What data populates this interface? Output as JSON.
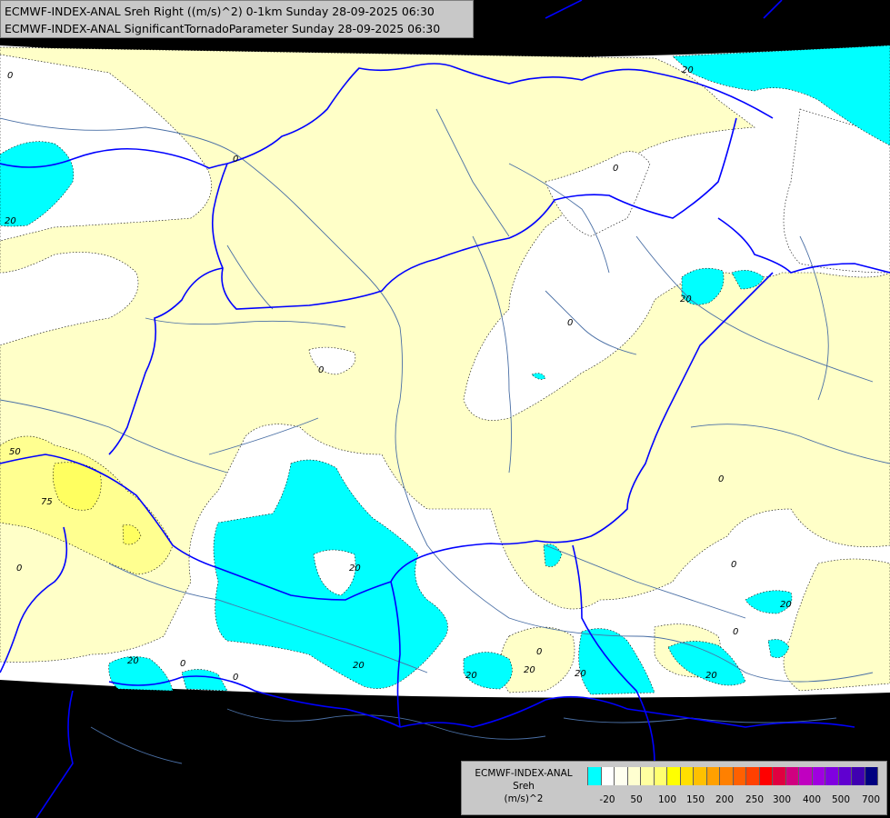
{
  "header": {
    "line1": "ECMWF-INDEX-ANAL Sreh Right ((m/s)^2) 0-1km Sunday 28-09-2025 06:30",
    "line2": "ECMWF-INDEX-ANAL SignificantTornadoParameter Sunday 28-09-2025 06:30"
  },
  "legend": {
    "title_line1": "ECMWF-INDEX-ANAL",
    "title_line2": "Sreh",
    "title_line3": "(m/s)^2",
    "swatch_colors": [
      "#00ffff",
      "#ffffff",
      "#fffff0",
      "#ffffd0",
      "#ffffa0",
      "#ffff70",
      "#ffff00",
      "#ffe000",
      "#ffc000",
      "#ffa000",
      "#ff8000",
      "#ff6000",
      "#ff4000",
      "#ff0000",
      "#e00040",
      "#d00080",
      "#c000c0",
      "#a000e0",
      "#8000e0",
      "#6000d0",
      "#4000b0",
      "#000080"
    ],
    "ticks": [
      "-20",
      "50",
      "100",
      "150",
      "200",
      "250",
      "300",
      "400",
      "500",
      "700"
    ]
  },
  "map_colors": {
    "background": "#000000",
    "white_field": "#ffffff",
    "pale_yellow": "#ffffc8",
    "yellow": "#ffff80",
    "cyan": "#00ffff",
    "border": "#0000ff",
    "river": "#4a6fa5"
  },
  "contour_labels": [
    {
      "text": "0"
    },
    {
      "text": "0"
    },
    {
      "text": "20"
    },
    {
      "text": "0"
    },
    {
      "text": "0"
    },
    {
      "text": "0"
    },
    {
      "text": "20"
    },
    {
      "text": "50"
    },
    {
      "text": "75"
    },
    {
      "text": "0"
    },
    {
      "text": "20"
    },
    {
      "text": "0"
    },
    {
      "text": "0"
    },
    {
      "text": "20"
    },
    {
      "text": "20"
    },
    {
      "text": "20"
    },
    {
      "text": "0"
    },
    {
      "text": "20"
    },
    {
      "text": "20"
    },
    {
      "text": "0"
    },
    {
      "text": "20"
    },
    {
      "text": "20"
    },
    {
      "text": "0"
    },
    {
      "text": "20"
    },
    {
      "text": "0"
    }
  ]
}
